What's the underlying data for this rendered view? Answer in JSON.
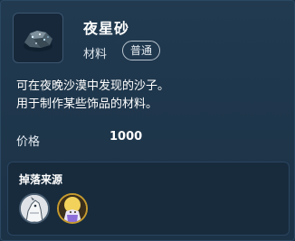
{
  "item": {
    "name": "夜星砂",
    "type": "材料",
    "rarity": "普通",
    "icon": "star-sand-icon",
    "description": [
      "可在夜晚沙漠中发现的沙子。",
      "用于制作某些饰品的材料。"
    ],
    "price_label": "价格",
    "price": "1000"
  },
  "drops": {
    "title": "掉落来源",
    "sources": [
      {
        "icon": "white-creature-avatar-icon"
      },
      {
        "icon": "golden-creature-avatar-icon"
      }
    ]
  },
  "colors": {
    "background": "#1d3448",
    "panel": "#172b3d",
    "border": "#2b4862",
    "text": "#ffffff",
    "gold_border": "#c59a2e"
  }
}
